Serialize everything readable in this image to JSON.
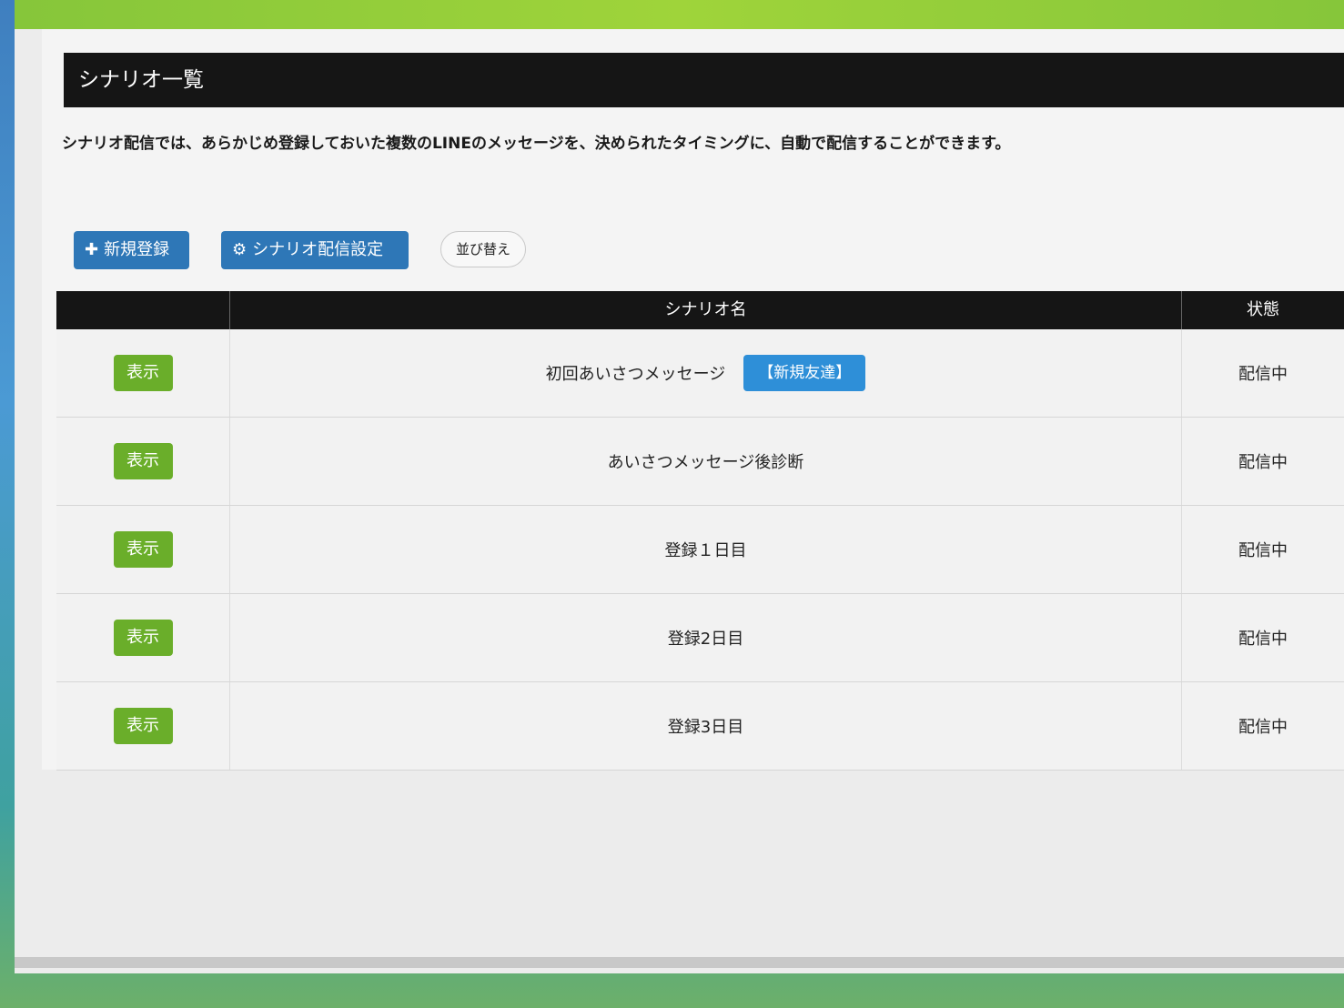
{
  "page": {
    "title": "シナリオ一覧",
    "description": "シナリオ配信では、あらかじめ登録しておいた複数のLINEのメッセージを、決められたタイミングに、自動で配信することができます。"
  },
  "toolbar": {
    "new_label": "新規登録",
    "settings_label": "シナリオ配信設定",
    "sort_label": "並び替え"
  },
  "table": {
    "headers": {
      "action": "",
      "name": "シナリオ名",
      "status": "状態"
    },
    "rows": [
      {
        "action": "表示",
        "name": "初回あいさつメッセージ",
        "tag": "【新規友達】",
        "status": "配信中"
      },
      {
        "action": "表示",
        "name": "あいさつメッセージ後診断",
        "tag": "",
        "status": "配信中"
      },
      {
        "action": "表示",
        "name": "登録１日目",
        "tag": "",
        "status": "配信中"
      },
      {
        "action": "表示",
        "name": "登録2日目",
        "tag": "",
        "status": "配信中"
      },
      {
        "action": "表示",
        "name": "登録3日目",
        "tag": "",
        "status": "配信中"
      }
    ]
  },
  "colors": {
    "accent_green": "#6aae2a",
    "primary_blue": "#2e77b7",
    "tag_blue": "#2e8fd8",
    "header_black": "#151515"
  },
  "icons": {
    "new": "plus-icon",
    "settings": "gear-icon"
  }
}
